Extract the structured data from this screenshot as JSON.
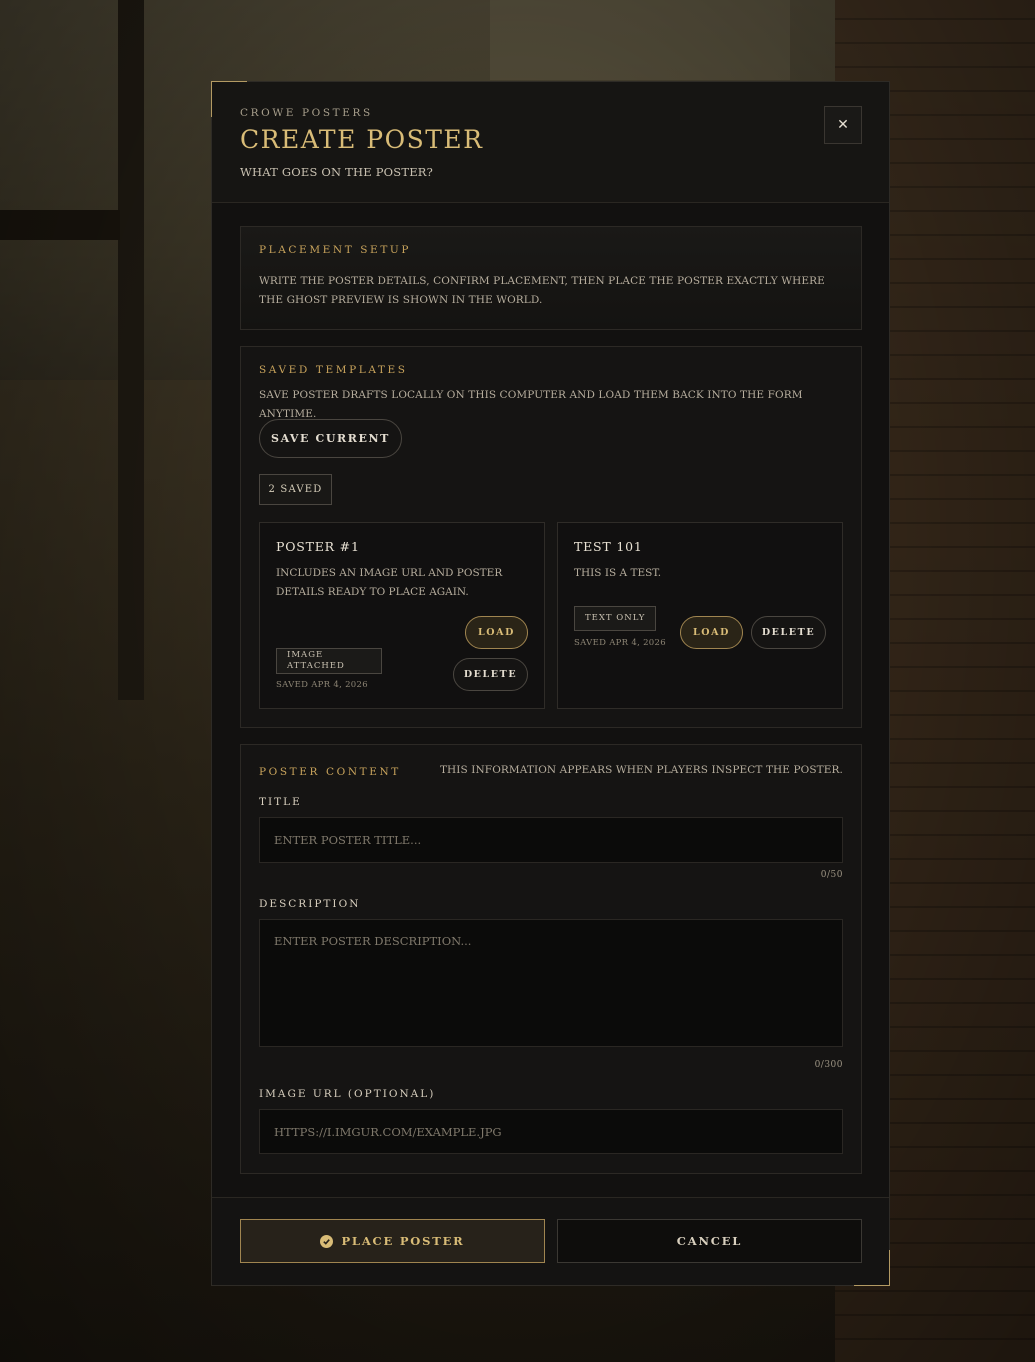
{
  "header": {
    "eyebrow": "Crowe Posters",
    "title": "Create Poster",
    "subtitle": "What goes on the poster?",
    "close_label": "✕"
  },
  "placement": {
    "label": "Placement Setup",
    "text": "Write the poster details, confirm placement, then place the poster exactly where the ghost preview is shown in the world."
  },
  "templates": {
    "label": "Saved Templates",
    "text": "Save poster drafts locally on this computer and load them back into the form anytime.",
    "save_current_label": "Save Current",
    "count_label": "2 Saved",
    "items": [
      {
        "title": "Poster #1",
        "description": "Includes an image URL and poster details ready to place again.",
        "tag": "Image attached",
        "saved": "Saved Apr 4, 2026",
        "load_label": "Load",
        "delete_label": "Delete"
      },
      {
        "title": "Test 101",
        "description": "This is a test.",
        "tag": "Text only",
        "saved": "Saved Apr 4, 2026",
        "load_label": "Load",
        "delete_label": "Delete"
      }
    ]
  },
  "content": {
    "label": "Poster Content",
    "hint": "This information appears when players inspect the poster.",
    "title_label": "Title",
    "title_placeholder": "Enter poster title...",
    "title_value": "",
    "title_counter": "0/50",
    "description_label": "Description",
    "description_placeholder": "Enter poster description...",
    "description_value": "",
    "description_counter": "0/300",
    "image_label": "Image URL (Optional)",
    "image_placeholder": "https://i.imgur.com/example.jpg",
    "image_value": ""
  },
  "footer": {
    "place_label": "Place Poster",
    "cancel_label": "Cancel"
  },
  "colors": {
    "accent": "#d9bc77",
    "panel": "#121110",
    "border": "#2c2925"
  }
}
